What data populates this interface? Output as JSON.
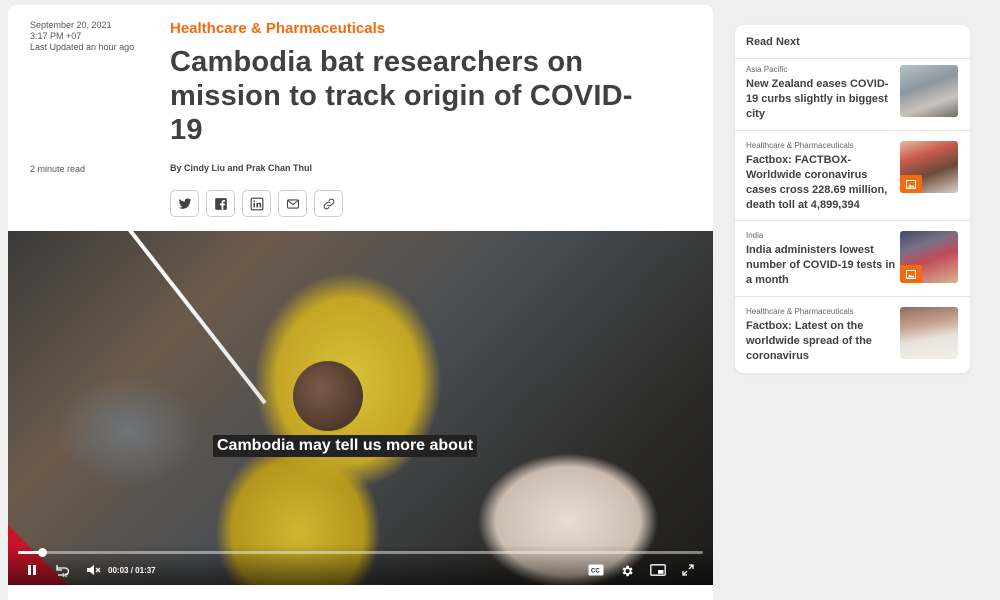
{
  "article": {
    "date": "September 20, 2021",
    "time": "3:17 PM +07",
    "last_updated": "Last Updated an hour ago",
    "read_time": "2 minute read",
    "section": "Healthcare & Pharmaceuticals",
    "headline": "Cambodia bat researchers on mission to track origin of COVID-19",
    "byline": "By Cindy Liu and Prak Chan Thul",
    "share_icons": [
      "twitter-icon",
      "facebook-icon",
      "linkedin-icon",
      "email-icon",
      "link-icon"
    ]
  },
  "video": {
    "caption": "Cambodia may tell us more about",
    "current_time": "00:03",
    "time_separator": "/",
    "duration": "01:37",
    "progress": 0.035,
    "icons": [
      "pause-icon",
      "replay-10-icon",
      "mute-icon",
      "cc-icon",
      "settings-icon",
      "pip-icon",
      "fullscreen-icon"
    ]
  },
  "sidebar": {
    "title": "Read Next",
    "stories": [
      {
        "category": "Asia Pacific",
        "title": "New Zealand eases COVID-19 curbs slightly in biggest city",
        "has_gallery_badge": false
      },
      {
        "category": "Healthcare & Pharmaceuticals",
        "title": "Factbox: FACTBOX-Worldwide coronavirus cases cross 228.69 million, death toll at 4,899,394",
        "has_gallery_badge": true
      },
      {
        "category": "India",
        "title": "India administers lowest number of COVID-19 tests in a month",
        "has_gallery_badge": true
      },
      {
        "category": "Healthcare & Pharmaceuticals",
        "title": "Factbox: Latest on the worldwide spread of the coronavirus",
        "has_gallery_badge": false
      }
    ]
  },
  "colors": {
    "accent": "#f36a10",
    "headline": "#404040",
    "brand_red": "#c9132a"
  }
}
